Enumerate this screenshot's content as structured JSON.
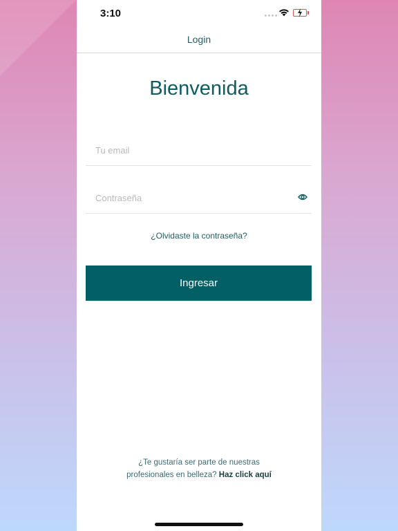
{
  "status_bar": {
    "time": "3:10"
  },
  "nav": {
    "title": "Login"
  },
  "welcome": {
    "heading": "Bienvenida"
  },
  "form": {
    "email_placeholder": "Tu email",
    "password_placeholder": "Contraseña",
    "forgot_password": "¿Olvidaste la contraseña?",
    "submit_label": "Ingresar"
  },
  "footer": {
    "line1": "¿Te gustaría ser parte de nuestras",
    "line2": "profesionales en belleza?",
    "link": "Haz click aquí"
  },
  "icons": {
    "signal": "cellular-signal-icon",
    "wifi": "wifi-icon",
    "battery": "battery-charging-icon",
    "password_toggle": "eye-icon"
  },
  "colors": {
    "primary": "#015f65",
    "heading": "#0d5c62",
    "battery_low": "#e05050",
    "background_top": "#df86b4",
    "background_bottom": "#bed8fc"
  }
}
